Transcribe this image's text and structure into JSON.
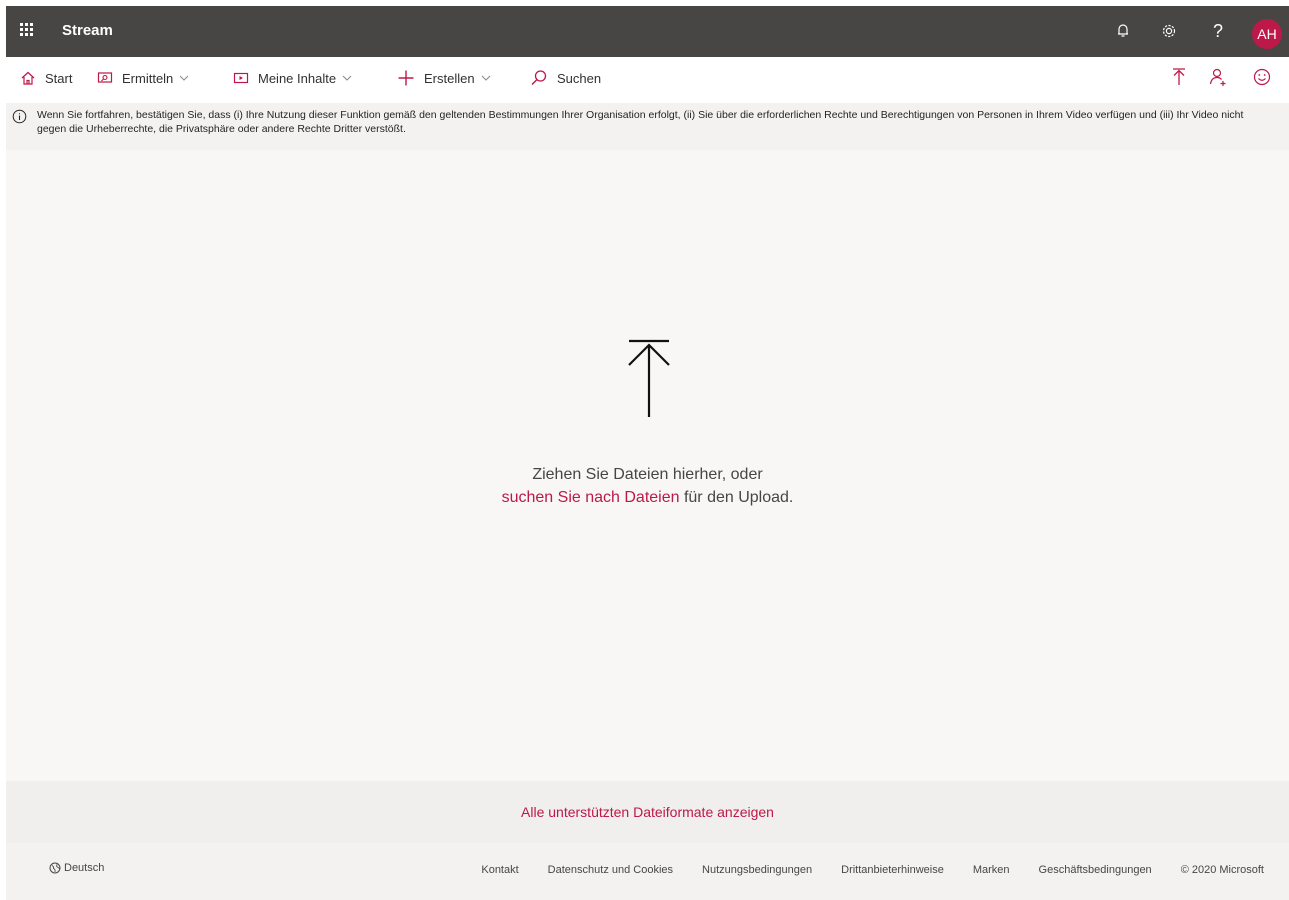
{
  "header": {
    "app_title": "Stream",
    "icons": [
      "waffle-icon",
      "bell-icon",
      "gear-icon",
      "help-icon"
    ],
    "help_glyph": "?",
    "avatar_initials": "AH",
    "accent_color": "#bc1948",
    "bar_color": "#484644"
  },
  "nav": {
    "items": [
      {
        "label": "Start",
        "icon": "home-icon"
      },
      {
        "label": "Ermitteln",
        "icon": "discover-icon",
        "dropdown": true
      },
      {
        "label": "Meine Inhalte",
        "icon": "video-icon",
        "dropdown": true
      },
      {
        "label": "Erstellen",
        "icon": "plus-icon",
        "dropdown": true
      },
      {
        "label": "Suchen",
        "icon": "search-icon"
      }
    ],
    "right_icons": [
      "upload-icon",
      "add-person-icon",
      "smiley-icon"
    ]
  },
  "banner": {
    "icon": "info-icon",
    "text": "Wenn Sie fortfahren, bestätigen Sie, dass (i) Ihre Nutzung dieser Funktion gemäß den geltenden Bestimmungen Ihrer Organisation erfolgt, (ii) Sie über die erforderlichen Rechte und Berechtigungen von Personen in Ihrem Video verfügen und (iii) Ihr Video nicht gegen die Urheberrechte, die Privatsphäre oder andere Rechte Dritter verstößt."
  },
  "dropzone": {
    "icon": "upload-arrow-icon",
    "line1": "Ziehen Sie Dateien hierher, oder",
    "browse_link": "suchen Sie nach Dateien",
    "line2_suffix": " für den Upload."
  },
  "formats_link": "Alle unterstützten Dateiformate anzeigen",
  "footer": {
    "language": "Deutsch",
    "links": [
      "Kontakt",
      "Datenschutz und Cookies",
      "Nutzungsbedingungen",
      "Drittanbieterhinweise",
      "Marken",
      "Geschäftsbedingungen"
    ],
    "copyright": "© 2020 Microsoft"
  }
}
